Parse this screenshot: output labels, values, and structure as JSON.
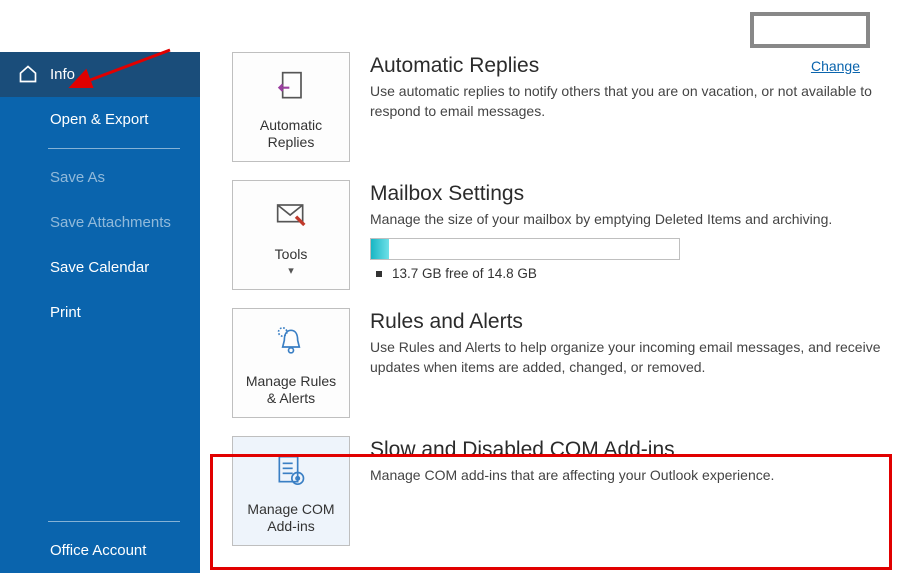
{
  "sidebar": {
    "items": [
      {
        "label": "Info"
      },
      {
        "label": "Open & Export"
      },
      {
        "label": "Save As"
      },
      {
        "label": "Save Attachments"
      },
      {
        "label": "Save Calendar"
      },
      {
        "label": "Print"
      }
    ],
    "bottom": {
      "label": "Office Account"
    }
  },
  "topRight": {
    "change": "Change"
  },
  "sections": {
    "autoReplies": {
      "tile": "Automatic\nReplies",
      "title": "Automatic Replies",
      "desc": "Use automatic replies to notify others that you are on vacation, or not available to respond to email messages."
    },
    "mailbox": {
      "tile": "Tools",
      "title": "Mailbox Settings",
      "desc": "Manage the size of your mailbox by emptying Deleted Items and archiving.",
      "storage": "13.7 GB free of 14.8 GB"
    },
    "rules": {
      "tile": "Manage Rules\n& Alerts",
      "title": "Rules and Alerts",
      "desc": "Use Rules and Alerts to help organize your incoming email messages, and receive updates when items are added, changed, or removed."
    },
    "addins": {
      "tile": "Manage COM\nAdd-ins",
      "title": "Slow and Disabled COM Add-ins",
      "desc": "Manage COM add-ins that are affecting your Outlook experience."
    }
  }
}
